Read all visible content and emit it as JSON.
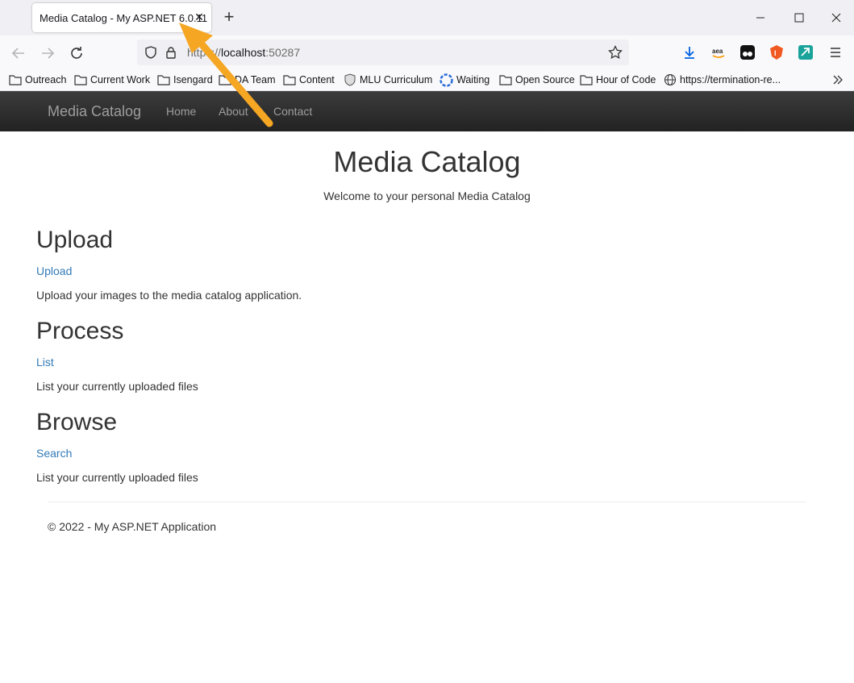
{
  "browser": {
    "tab_title": "Media Catalog - My ASP.NET 6.0.11",
    "tab_close": "✕",
    "new_tab": "+",
    "url_scheme": "https://",
    "url_host": "localhost",
    "url_port": ":50287",
    "bookmarks": [
      "Outreach",
      "Current Work",
      "Isengard",
      "DA Team",
      "Content",
      "MLU Curriculum",
      "Waiting",
      "Open Source",
      "Hour of Code",
      "https://termination-re..."
    ],
    "extensions": [
      "download-icon",
      "amazon-icon",
      "tampermonkey-icon",
      "brave-icon",
      "extension-icon",
      "menu-icon"
    ]
  },
  "site": {
    "brand": "Media Catalog",
    "nav": [
      "Home",
      "About",
      "Contact"
    ]
  },
  "main": {
    "title": "Media Catalog",
    "subtitle": "Welcome to your personal Media Catalog",
    "sections": [
      {
        "heading": "Upload",
        "link": "Upload",
        "desc": "Upload your images to the media catalog application."
      },
      {
        "heading": "Process",
        "link": "List",
        "desc": "List your currently uploaded files"
      },
      {
        "heading": "Browse",
        "link": "Search",
        "desc": "List your currently uploaded files"
      }
    ],
    "footer": "© 2022 - My ASP.NET Application"
  },
  "colors": {
    "link": "#337ab7",
    "annotation_arrow": "#f5a623",
    "navbar": "#222222"
  }
}
